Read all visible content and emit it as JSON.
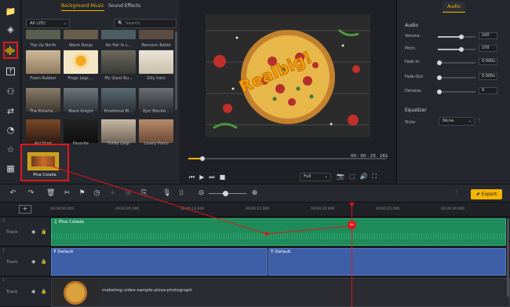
{
  "media_panel": {
    "tabs": [
      "Background Music",
      "Sound Effects"
    ],
    "filter_value": "All (25)",
    "search_placeholder": "Search",
    "items": [
      {
        "label": "Trip Up North"
      },
      {
        "label": "Warm Banjo"
      },
      {
        "label": "Als Fair In L..."
      },
      {
        "label": "Barroom Ballet"
      },
      {
        "label": "Foam Rubber"
      },
      {
        "label": "Frogs Legs ..."
      },
      {
        "label": "My Giant Bu..."
      },
      {
        "label": "Silly Intro"
      },
      {
        "label": "The Enterta..."
      },
      {
        "label": "Black Knight"
      },
      {
        "label": "Emotional Bl..."
      },
      {
        "label": "Epic Blockb..."
      },
      {
        "label": "Ant Hunt"
      },
      {
        "label": "Favorite"
      },
      {
        "label": "Funky Loop"
      },
      {
        "label": "Lovely Piano"
      }
    ],
    "selected_item": "Pina Colada"
  },
  "preview": {
    "overlay_text": "Realbig!",
    "timecode": "00 : 00 : 23 . 161",
    "zoom_value": "Full",
    "playhead_fraction": 0.07
  },
  "audio_panel": {
    "tab": "Audio",
    "section_audio": "Audio",
    "volume_label": "Volume:",
    "volume_value": "100",
    "pitch_label": "Pitch:",
    "pitch_value": "100",
    "fade_in_label": "Fade In:",
    "fade_in_value": "0.000s",
    "fade_out_label": "Fade Out:",
    "fade_out_value": "0.000s",
    "denoise_label": "Denoise:",
    "denoise_value": "0",
    "section_equalizer": "Equalizer",
    "style_label": "Style:",
    "style_value": "None"
  },
  "toolbar": {
    "export_label": "Export"
  },
  "timeline": {
    "ticks": [
      "00:00:00.000",
      "00:00:05.000",
      "00:00:10.000",
      "00:00:15.000",
      "00:00:20.000",
      "00:00:25.000",
      "00:00:30.000"
    ],
    "track_label": "Track",
    "track_numbers": [
      "3",
      "2",
      "1"
    ],
    "audio_clip": "Pina Colada",
    "text_clip_1": "Default",
    "text_clip_2": "Default",
    "video_clip": "maketing-video-sample-pizza-photograph"
  },
  "colors": {
    "accent": "#f0b400",
    "highlight": "#e0171c",
    "audio_track": "#1f8b5a",
    "text_track": "#3d5fa8"
  }
}
